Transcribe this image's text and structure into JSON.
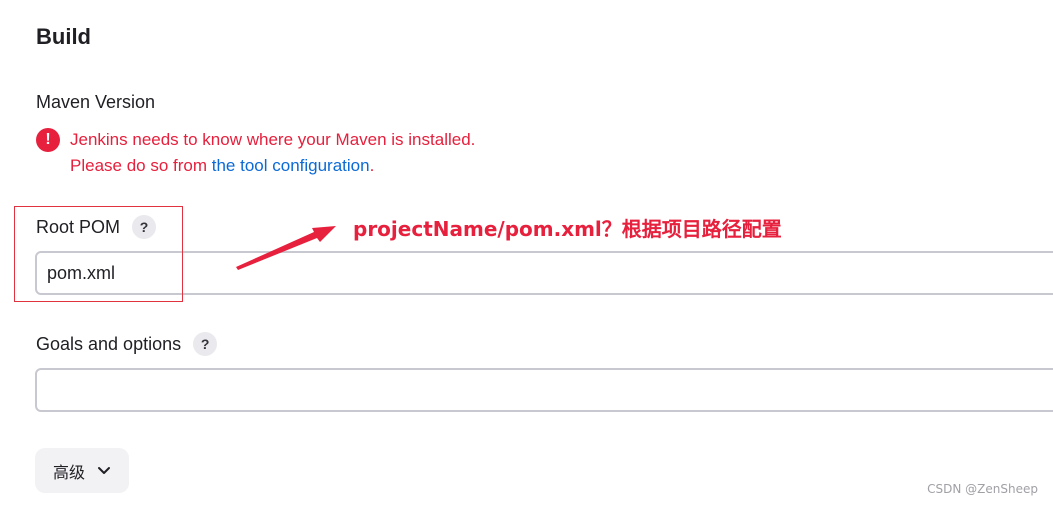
{
  "section": {
    "title": "Build"
  },
  "maven": {
    "label": "Maven Version",
    "error_line1": "Jenkins needs to know where your Maven is installed.",
    "error_line2_prefix": "Please do so from ",
    "error_link": "the tool configuration",
    "error_line2_suffix": ".",
    "error_icon": "!"
  },
  "root_pom": {
    "label": "Root POM",
    "help": "?",
    "value": "pom.xml"
  },
  "goals": {
    "label": "Goals and options",
    "help": "?",
    "value": ""
  },
  "advanced": {
    "label": "高级",
    "chevron": "⌄"
  },
  "annotation": {
    "text": "projectName/pom.xml？根据项目路径配置"
  },
  "watermark": "CSDN @ZenSheep",
  "colors": {
    "error": "#e6203d",
    "link": "#0b6ad6",
    "annotation": "#e6203d"
  }
}
